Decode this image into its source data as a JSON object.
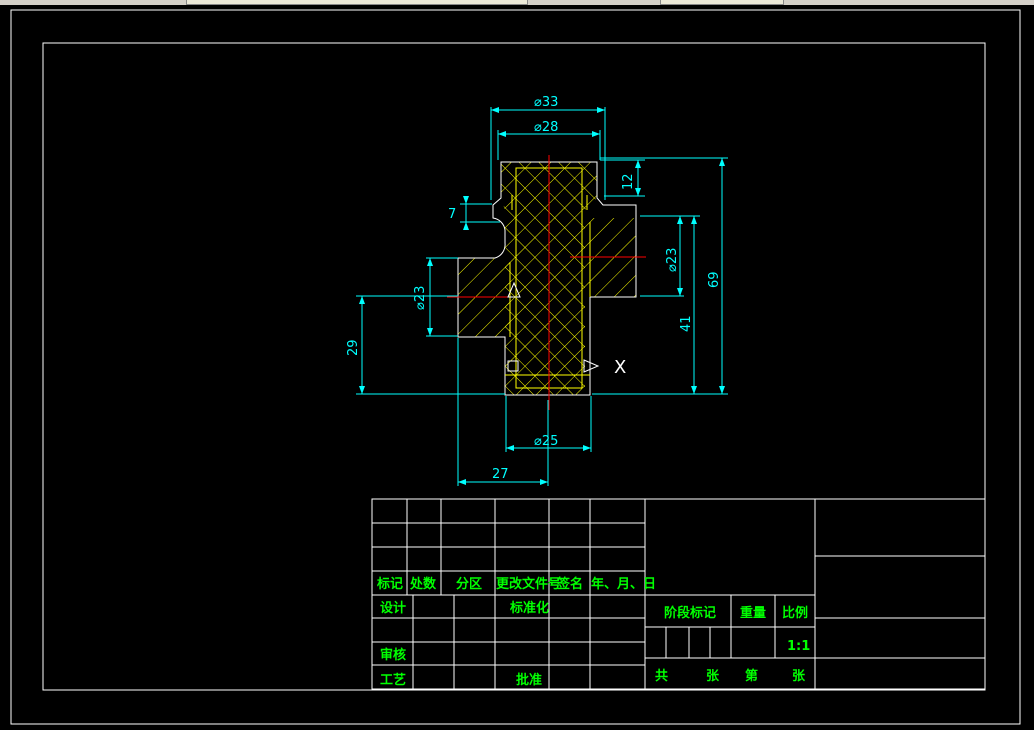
{
  "colors": {
    "background": "#000000",
    "frame": "#ffffff",
    "dimension": "#00ffff",
    "hatch": "#ffff00",
    "outline": "#ffff00",
    "centerline": "#ff0000",
    "title_text": "#00ff00"
  },
  "dimensions": {
    "d33": "⌀33",
    "d28": "⌀28",
    "d25": "⌀25",
    "d23_left": "⌀23",
    "d23_right": "⌀23",
    "h12": "12",
    "h7": "7",
    "h69": "69",
    "h41": "41",
    "h29": "29",
    "w27": "27"
  },
  "cursor_label": "X",
  "title_block": {
    "col_headers": [
      "标记",
      "处数",
      "分区",
      "更改文件号",
      "签名",
      "年、月、日"
    ],
    "design": "设计",
    "standardize": "标准化",
    "review": "审核",
    "process": "工艺",
    "approve": "批准",
    "stage_mark": "阶段标记",
    "weight": "重量",
    "scale_label": "比例",
    "scale_value": "1:1",
    "total": "共",
    "sheets": "张",
    "sheet_no": "第",
    "sheet_unit": "张"
  }
}
